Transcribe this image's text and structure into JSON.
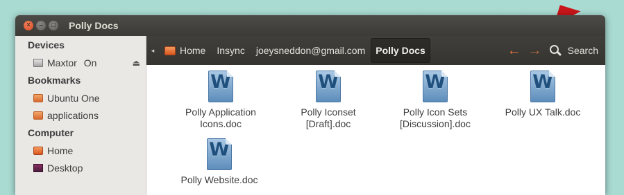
{
  "window": {
    "title": "Polly Docs"
  },
  "sidebar": {
    "sections": [
      {
        "heading": "Devices",
        "items": [
          {
            "label": "Maxtor",
            "status": "On",
            "icon": "drive-icon",
            "eject": "⏏"
          }
        ]
      },
      {
        "heading": "Bookmarks",
        "items": [
          {
            "label": "Ubuntu One",
            "icon": "folder-icon"
          },
          {
            "label": "applications",
            "icon": "folder-icon"
          }
        ]
      },
      {
        "heading": "Computer",
        "items": [
          {
            "label": "Home",
            "icon": "home-folder-icon"
          },
          {
            "label": "Desktop",
            "icon": "desktop-icon"
          }
        ]
      }
    ]
  },
  "toolbar": {
    "breadcrumbs": [
      "Home",
      "Insync",
      "joeysneddon@gmail.com",
      "Polly Docs"
    ],
    "search_label": "Search",
    "accent_color": "#f0773a"
  },
  "files": [
    {
      "icon_letter": "W",
      "name_line1": "Polly Application",
      "name_line2": "Icons.doc"
    },
    {
      "icon_letter": "W",
      "name_line1": "Polly Iconset",
      "name_line2": "[Draft].doc"
    },
    {
      "icon_letter": "W",
      "name_line1": "Polly Icon Sets",
      "name_line2": "[Discussion].doc"
    },
    {
      "icon_letter": "W",
      "name_line1": "Polly UX Talk.doc",
      "name_line2": ""
    },
    {
      "icon_letter": "W",
      "name_line1": "Polly Website.doc",
      "name_line2": ""
    }
  ]
}
